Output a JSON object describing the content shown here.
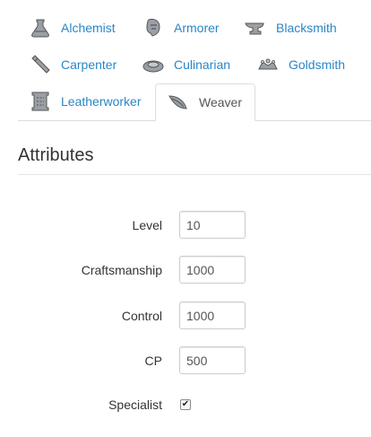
{
  "jobs": [
    {
      "label": "Alchemist",
      "icon": "alchemist-icon"
    },
    {
      "label": "Armorer",
      "icon": "armorer-icon"
    },
    {
      "label": "Blacksmith",
      "icon": "blacksmith-icon"
    },
    {
      "label": "Carpenter",
      "icon": "carpenter-icon"
    },
    {
      "label": "Culinarian",
      "icon": "culinarian-icon"
    },
    {
      "label": "Goldsmith",
      "icon": "goldsmith-icon"
    },
    {
      "label": "Leatherworker",
      "icon": "leatherworker-icon"
    },
    {
      "label": "Weaver",
      "icon": "weaver-icon",
      "active": true
    }
  ],
  "section": {
    "title": "Attributes"
  },
  "form": {
    "level": {
      "label": "Level",
      "value": "10"
    },
    "craftsmanship": {
      "label": "Craftsmanship",
      "value": "1000"
    },
    "control": {
      "label": "Control",
      "value": "1000"
    },
    "cp": {
      "label": "CP",
      "value": "500"
    },
    "specialist": {
      "label": "Specialist",
      "checked": true
    }
  },
  "colors": {
    "link": "#2a86c6",
    "active_tab_text": "#555555",
    "border": "#dddddd"
  }
}
